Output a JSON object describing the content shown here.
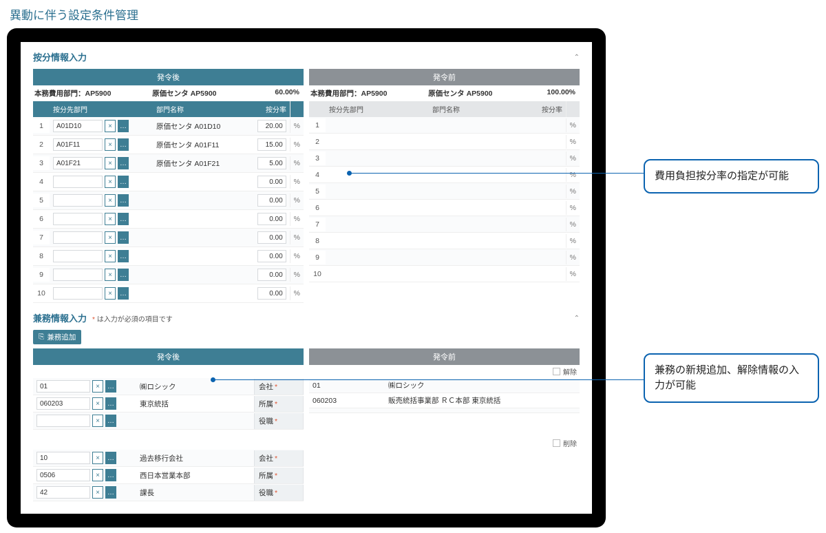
{
  "page_title": "異動に伴う設定条件管理",
  "allocation": {
    "section_title": "按分情報入力",
    "after": {
      "header": "発令後",
      "summary": {
        "dept": "本務費用部門：AP5900",
        "center": "原価センタ AP5900",
        "pct": "60.00%"
      },
      "columns": {
        "dept": "按分先部門",
        "name": "部門名称",
        "rate": "按分率"
      },
      "rows": [
        {
          "code": "A01D10",
          "name": "原価センタ A01D10",
          "rate": "20.00"
        },
        {
          "code": "A01F11",
          "name": "原価センタ A01F11",
          "rate": "15.00"
        },
        {
          "code": "A01F21",
          "name": "原価センタ A01F21",
          "rate": "5.00"
        },
        {
          "code": "",
          "name": "",
          "rate": "0.00"
        },
        {
          "code": "",
          "name": "",
          "rate": "0.00"
        },
        {
          "code": "",
          "name": "",
          "rate": "0.00"
        },
        {
          "code": "",
          "name": "",
          "rate": "0.00"
        },
        {
          "code": "",
          "name": "",
          "rate": "0.00"
        },
        {
          "code": "",
          "name": "",
          "rate": "0.00"
        },
        {
          "code": "",
          "name": "",
          "rate": "0.00"
        }
      ],
      "unit": "%"
    },
    "before": {
      "header": "発令前",
      "summary": {
        "dept": "本務費用部門：AP5900",
        "center": "原価センタ AP5900",
        "pct": "100.00%"
      },
      "columns": {
        "dept": "按分先部門",
        "name": "部門名称",
        "rate": "按分率"
      },
      "rows": [
        {
          "rate": ""
        },
        {
          "rate": ""
        },
        {
          "rate": ""
        },
        {
          "rate": ""
        },
        {
          "rate": ""
        },
        {
          "rate": ""
        },
        {
          "rate": ""
        },
        {
          "rate": ""
        },
        {
          "rate": ""
        },
        {
          "rate": ""
        }
      ],
      "unit": "%"
    }
  },
  "concurrent": {
    "section_title": "兼務情報入力",
    "required_note_prefix": "*",
    "required_note": " は入力が必須の項目です",
    "add_button": "兼務追加",
    "after_header": "発令後",
    "before_header": "発令前",
    "release_label": "解除",
    "delete_label": "削除",
    "labels": {
      "company": "会社",
      "org": "所属",
      "position": "役職"
    },
    "after_block1": {
      "rows": [
        {
          "code": "01",
          "name": "㈱ロシック",
          "label_key": "company"
        },
        {
          "code": "060203",
          "name": "東京統括",
          "label_key": "org"
        },
        {
          "code": "",
          "name": "",
          "label_key": "position"
        }
      ]
    },
    "before_block1": {
      "rows": [
        {
          "code": "01",
          "name": "㈱ロシック"
        },
        {
          "code": "060203",
          "name": "販売統括事業部 ＲＣ本部 東京統括"
        },
        {
          "code": "",
          "name": ""
        }
      ]
    },
    "after_block2": {
      "rows": [
        {
          "code": "10",
          "name": "過去移行会社",
          "label_key": "company"
        },
        {
          "code": "0506",
          "name": "西日本営業本部",
          "label_key": "org"
        },
        {
          "code": "42",
          "name": "課長",
          "label_key": "position"
        }
      ]
    }
  },
  "icons": {
    "clear": "×",
    "lookup": "…",
    "add": "⎘",
    "collapse": "⌃"
  },
  "callouts": {
    "c1": "費用負担按分率の指定が可能",
    "c2": "兼務の新規追加、解除情報の入力が可能"
  }
}
